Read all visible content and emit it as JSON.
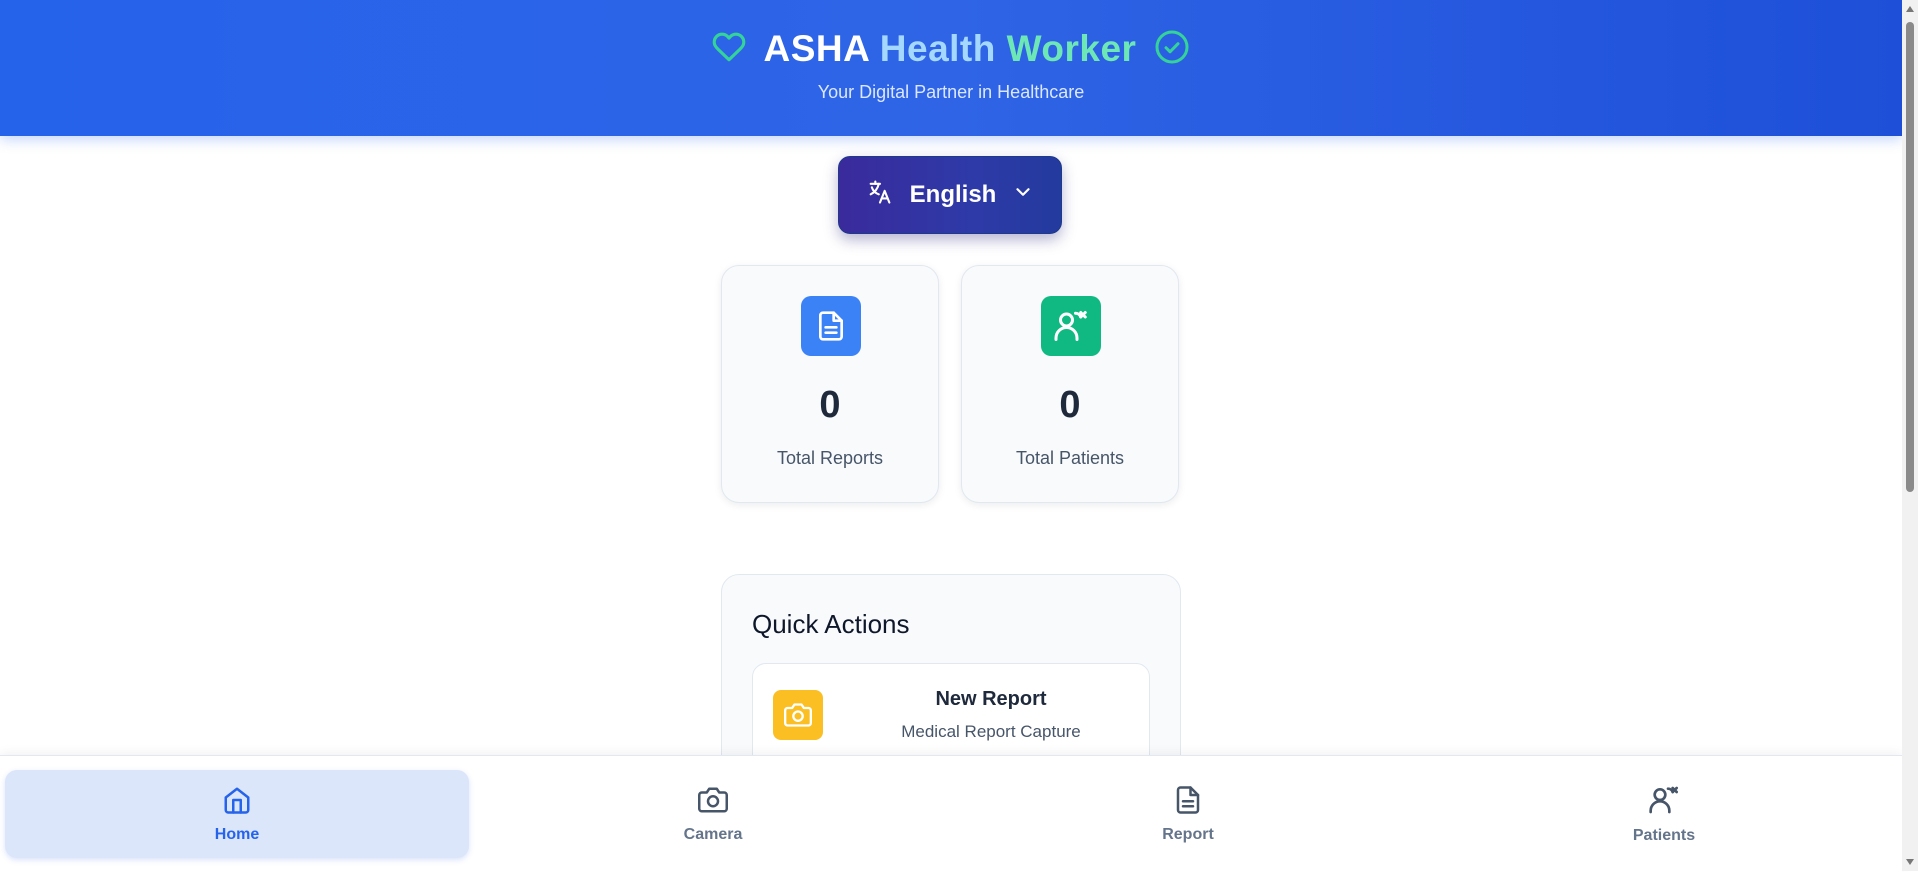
{
  "header": {
    "title_part1": "ASHA",
    "title_part2": "Health",
    "title_part3": "Worker",
    "subtitle": "Your Digital Partner in Healthcare",
    "left_icon": "heart-icon",
    "right_icon": "check-circle-icon"
  },
  "language": {
    "label": "English",
    "icon": "translate-icon",
    "chevron": "chevron-down-icon"
  },
  "stats": [
    {
      "value": "0",
      "label": "Total Reports",
      "icon": "file-text-icon",
      "color": "#3b82f6"
    },
    {
      "value": "0",
      "label": "Total Patients",
      "icon": "patients-icon",
      "color": "#10b981"
    }
  ],
  "quick_actions": {
    "title": "Quick Actions",
    "items": [
      {
        "name": "New Report",
        "description": "Medical Report Capture",
        "icon": "camera-icon",
        "color": "#fbbf24"
      }
    ]
  },
  "bottom_nav": [
    {
      "label": "Home",
      "icon": "home-icon",
      "active": true
    },
    {
      "label": "Camera",
      "icon": "camera-icon",
      "active": false
    },
    {
      "label": "Report",
      "icon": "file-text-icon",
      "active": false
    },
    {
      "label": "Patients",
      "icon": "patients-icon",
      "active": false
    }
  ],
  "colors": {
    "header_bg": "#2563eb",
    "accent_green": "#34d399",
    "accent_blue": "#2563eb"
  }
}
